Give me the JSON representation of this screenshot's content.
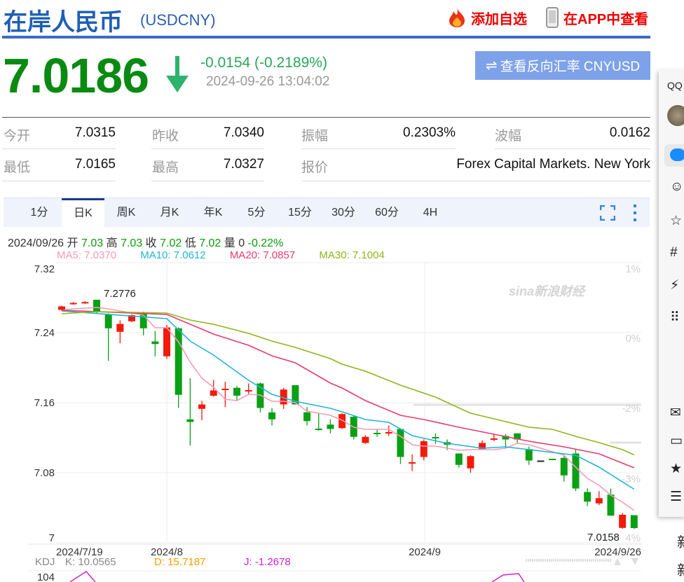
{
  "header": {
    "title": "在岸人民币",
    "code": "(USDCNY)",
    "add_watch": "添加自选",
    "view_app": "在APP中查看"
  },
  "quote": {
    "price": "7.0186",
    "direction": "down",
    "change": "-0.0154 (-0.2189%)",
    "time": "2024-09-26 13:04:02",
    "reverse_button": "查看反向汇率 CNYUSD"
  },
  "stats": [
    {
      "label": "今开",
      "value": "7.0315"
    },
    {
      "label": "昨收",
      "value": "7.0340"
    },
    {
      "label": "振幅",
      "value": "0.2303%"
    },
    {
      "label": "波幅",
      "value": "0.0162"
    },
    {
      "label": "最低",
      "value": "7.0165"
    },
    {
      "label": "最高",
      "value": "7.0327"
    },
    {
      "label": "报价",
      "value": "Forex Capital Markets. New York"
    }
  ],
  "tabs": [
    "1分",
    "日K",
    "周K",
    "月K",
    "年K",
    "5分",
    "15分",
    "30分",
    "60分",
    "4H"
  ],
  "active_tab": "日K",
  "info": {
    "date": "2024/09/26",
    "open_label": "开",
    "open": "7.03",
    "high_label": "高",
    "high": "7.03",
    "close_label": "收",
    "close": "7.02",
    "low_label": "低",
    "low": "7.02",
    "vol_label": "量",
    "vol": "0",
    "pct": "-0.22%"
  },
  "ma_legend": [
    {
      "text": "MA5: 7.0370",
      "color": "#f59ab6"
    },
    {
      "text": "MA10: 7.0612",
      "color": "#1fb5d8"
    },
    {
      "text": "MA20: 7.0857",
      "color": "#e83a6e"
    },
    {
      "text": "MA30: 7.1004",
      "color": "#8db61a"
    }
  ],
  "watermark": "sina新浪财经",
  "kdj": {
    "label": "KDJ",
    "k": "K: 10.0565",
    "d": "D: 15.7187",
    "j": "J: -1.2678",
    "axis_top": "104"
  },
  "colors": {
    "up": "#f21a0a",
    "down": "#0aa015",
    "flat": "#222"
  },
  "chart_data": {
    "type": "candlestick",
    "ylim": [
      7.0,
      7.32
    ],
    "y_ticks": [
      "7.32",
      "7.24",
      "7.16",
      "7.08",
      "7"
    ],
    "pct_ticks": [
      "1%",
      "0%",
      "-2%",
      "-3%",
      "4%"
    ],
    "x_ticks": [
      {
        "label": "2024/7/19",
        "index": 1
      },
      {
        "label": "2024/8",
        "index": 10
      },
      {
        "label": "2024/9",
        "index": 32
      },
      {
        "label": "2024/9/26",
        "index": 50
      }
    ],
    "annotations": [
      {
        "text": "7.2776",
        "index": 4,
        "value": 7.2776
      },
      {
        "text": "7.0158",
        "index": 50,
        "value": 7.0158
      }
    ],
    "ohlc": [
      [
        7.266,
        7.27,
        7.271,
        7.265
      ],
      [
        7.273,
        7.274,
        7.275,
        7.272
      ],
      [
        7.274,
        7.275,
        7.276,
        7.273
      ],
      [
        7.2776,
        7.264,
        7.2776,
        7.262
      ],
      [
        7.261,
        7.245,
        7.262,
        7.208
      ],
      [
        7.241,
        7.25,
        7.254,
        7.228
      ],
      [
        7.253,
        7.26,
        7.261,
        7.252
      ],
      [
        7.263,
        7.245,
        7.264,
        7.237
      ],
      [
        7.23,
        7.227,
        7.242,
        7.213
      ],
      [
        7.213,
        7.246,
        7.249,
        7.21
      ],
      [
        7.245,
        7.169,
        7.246,
        7.154
      ],
      [
        7.141,
        7.138,
        7.188,
        7.111
      ],
      [
        7.153,
        7.158,
        7.162,
        7.14
      ],
      [
        7.168,
        7.174,
        7.186,
        7.167
      ],
      [
        7.175,
        7.176,
        7.184,
        7.155
      ],
      [
        7.177,
        7.168,
        7.179,
        7.162
      ],
      [
        7.1736,
        7.1744,
        7.182,
        7.17
      ],
      [
        7.182,
        7.154,
        7.183,
        7.149
      ],
      [
        7.149,
        7.141,
        7.154,
        7.134
      ],
      [
        7.158,
        7.175,
        7.177,
        7.153
      ],
      [
        7.18,
        7.158,
        7.18,
        7.158
      ],
      [
        7.149,
        7.139,
        7.155,
        7.134
      ],
      [
        7.1304,
        7.1296,
        7.148,
        7.128
      ],
      [
        7.135,
        7.13,
        7.141,
        7.125
      ],
      [
        7.131,
        7.147,
        7.148,
        7.13
      ],
      [
        7.144,
        7.121,
        7.145,
        7.118
      ],
      [
        7.114,
        7.121,
        7.123,
        7.113
      ],
      [
        7.1256,
        7.124,
        7.13,
        7.121
      ],
      [
        7.1248,
        7.1264,
        7.134,
        7.122
      ],
      [
        7.13,
        7.098,
        7.13,
        7.09
      ],
      [
        7.091,
        7.092,
        7.101,
        7.082
      ],
      [
        7.098,
        7.116,
        7.118,
        7.094
      ],
      [
        7.1208,
        7.12,
        7.125,
        7.113
      ],
      [
        7.115,
        7.112,
        7.118,
        7.106
      ],
      [
        7.102,
        7.089,
        7.102,
        7.086
      ],
      [
        7.085,
        7.099,
        7.1,
        7.08
      ],
      [
        7.107,
        7.114,
        7.117,
        7.106
      ],
      [
        7.1176,
        7.1192,
        7.124,
        7.116
      ],
      [
        7.122,
        7.118,
        7.124,
        7.108
      ],
      [
        7.125,
        7.118,
        7.125,
        7.114
      ],
      [
        7.107,
        7.094,
        7.11,
        7.089
      ],
      [
        7.094,
        7.094,
        7.094,
        7.094
      ],
      [
        7.096,
        7.0955,
        7.096,
        7.0955
      ],
      [
        7.097,
        7.077,
        7.099,
        7.07
      ],
      [
        7.102,
        7.062,
        7.107,
        7.059
      ],
      [
        7.058,
        7.047,
        7.062,
        7.042
      ],
      [
        7.045,
        7.051,
        7.059,
        7.043
      ],
      [
        7.055,
        7.031,
        7.062,
        7.031
      ],
      [
        7.017,
        7.032,
        7.034,
        7.016
      ],
      [
        7.0315,
        7.0168,
        7.0315,
        7.0158
      ]
    ],
    "series": [
      {
        "name": "MA5",
        "color": "#f59ab6",
        "values": [
          7.2656,
          7.2672,
          7.268,
          7.2688,
          7.2672,
          7.2648,
          7.2624,
          7.26,
          7.2456,
          7.2456,
          7.2296,
          7.2064,
          7.188,
          7.1776,
          7.164,
          7.1624,
          7.1696,
          7.1688,
          7.1616,
          7.1616,
          7.16,
          7.1504,
          7.148,
          7.1456,
          7.14,
          7.132,
          7.1296,
          7.1296,
          7.1296,
          7.1216,
          7.112,
          7.1104,
          7.1104,
          7.108,
          7.1056,
          7.1064,
          7.1064,
          7.1064,
          7.108,
          7.1136,
          7.112,
          7.108,
          7.104,
          7.1,
          7.0864,
          7.0736,
          7.0656,
          7.0544,
          7.0464,
          7.037
        ]
      },
      {
        "name": "MA10",
        "color": "#1fb5d8",
        "points": [
          [
            1,
            7.2648
          ],
          [
            10,
            7.256
          ],
          [
            12,
            7.2304
          ],
          [
            14,
            7.2144
          ],
          [
            17,
            7.1856
          ],
          [
            19,
            7.1696
          ],
          [
            21,
            7.1616
          ],
          [
            24,
            7.1536
          ],
          [
            25,
            7.1496
          ],
          [
            27,
            7.1408
          ],
          [
            29,
            7.1376
          ],
          [
            31,
            7.1224
          ],
          [
            34,
            7.1136
          ],
          [
            37,
            7.108
          ],
          [
            39,
            7.1096
          ],
          [
            41,
            7.1064
          ],
          [
            45,
            7.1
          ],
          [
            47,
            7.0864
          ],
          [
            50,
            7.0612
          ]
        ]
      },
      {
        "name": "MA20",
        "color": "#e83a6e",
        "points": [
          [
            1,
            7.2656
          ],
          [
            10,
            7.2608
          ],
          [
            12,
            7.2496
          ],
          [
            14,
            7.2384
          ],
          [
            17,
            7.2256
          ],
          [
            19,
            7.2136
          ],
          [
            21,
            7.2056
          ],
          [
            24,
            7.1824
          ],
          [
            25,
            7.1768
          ],
          [
            27,
            7.1624
          ],
          [
            30,
            7.1456
          ],
          [
            32,
            7.1408
          ],
          [
            35,
            7.132
          ],
          [
            38,
            7.124
          ],
          [
            41,
            7.116
          ],
          [
            44,
            7.1096
          ],
          [
            47,
            7.1016
          ],
          [
            50,
            7.0857
          ]
        ]
      },
      {
        "name": "MA30",
        "color": "#8db61a",
        "points": [
          [
            1,
            7.2616
          ],
          [
            4,
            7.264
          ],
          [
            10,
            7.2624
          ],
          [
            12,
            7.2544
          ],
          [
            14,
            7.2496
          ],
          [
            17,
            7.2392
          ],
          [
            19,
            7.2304
          ],
          [
            21,
            7.2232
          ],
          [
            24,
            7.2104
          ],
          [
            25,
            7.204
          ],
          [
            27,
            7.196
          ],
          [
            30,
            7.18
          ],
          [
            33,
            7.1664
          ],
          [
            36,
            7.148
          ],
          [
            41,
            7.132
          ],
          [
            43,
            7.1296
          ],
          [
            45,
            7.1216
          ],
          [
            47,
            7.1144
          ],
          [
            49,
            7.1064
          ],
          [
            50,
            7.1004
          ]
        ]
      }
    ]
  },
  "side_icons": [
    "qq-icon",
    "avatar",
    "message-icon",
    "contacts-icon",
    "star-icon",
    "hashtag-icon",
    "flash-icon",
    "apps-icon",
    "mail-icon",
    "folder-icon",
    "bookmark-icon",
    "menu-icon"
  ],
  "side_text": "新"
}
